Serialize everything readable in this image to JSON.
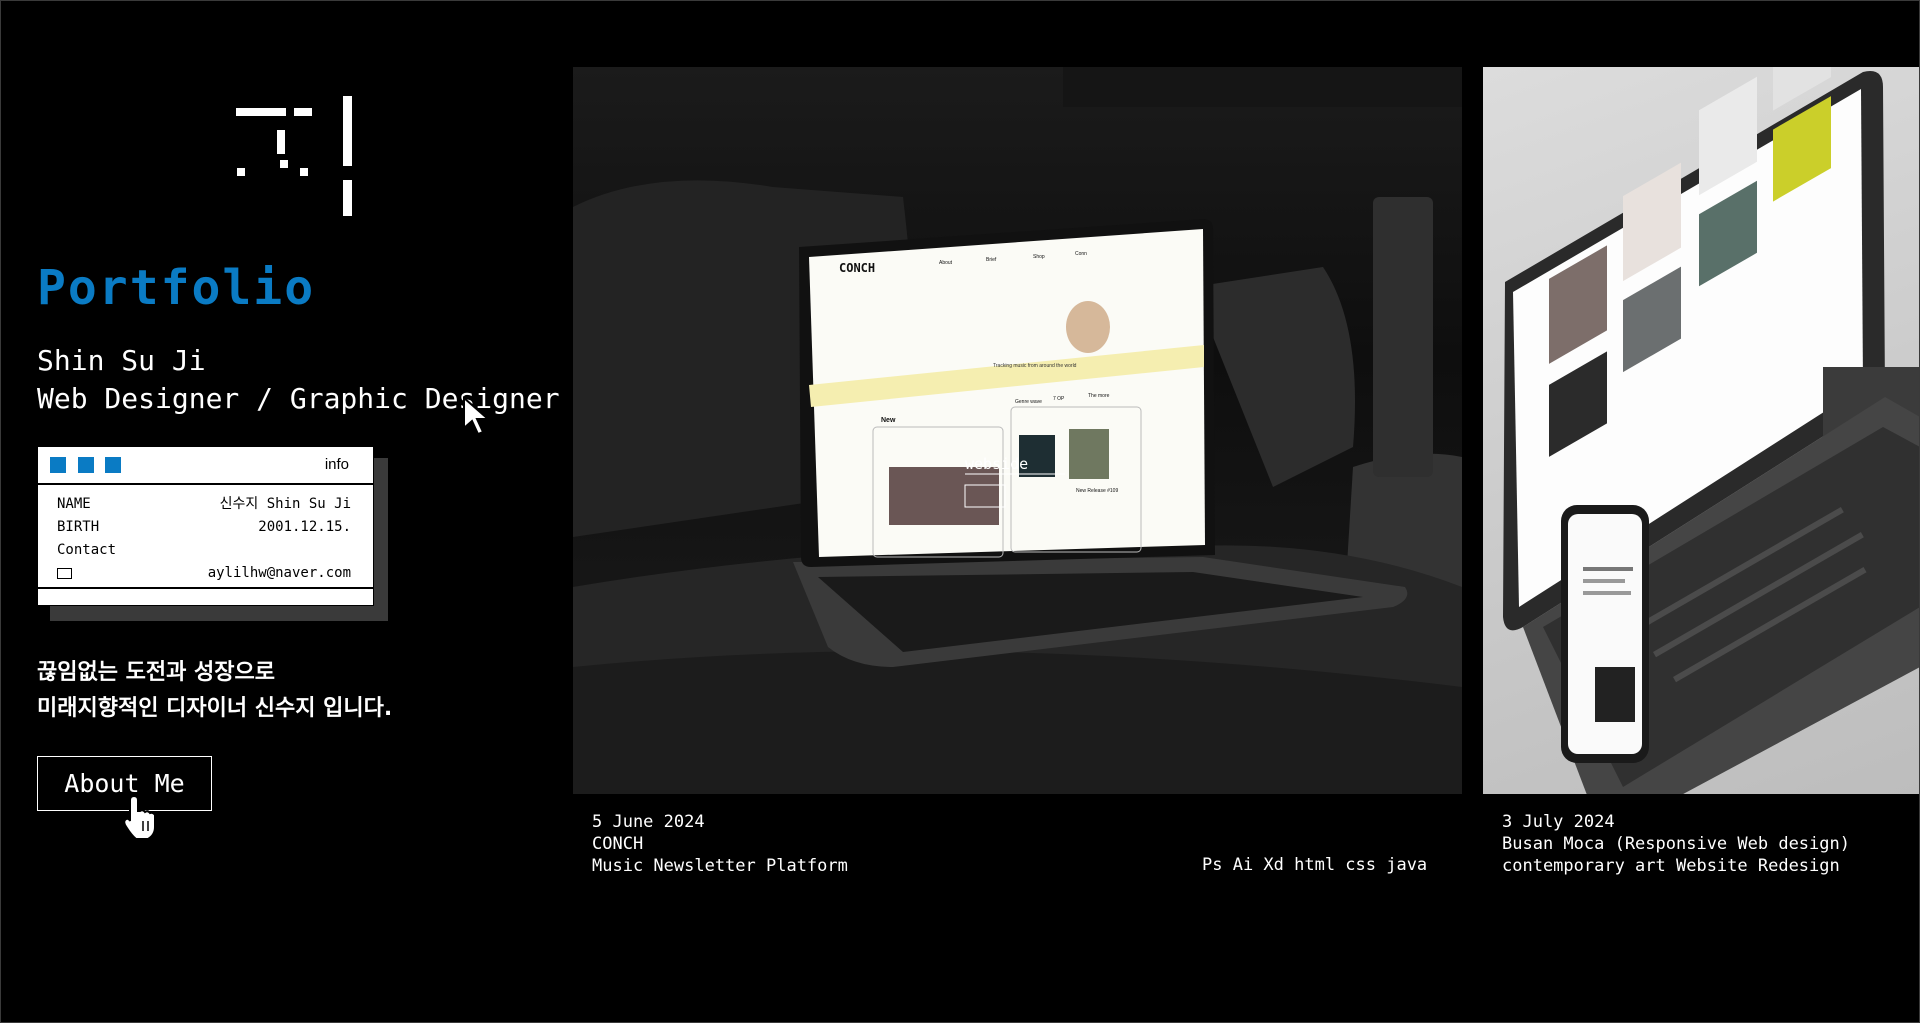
{
  "hero": {
    "title": "Portfolio",
    "name": "Shin Su Ji",
    "role": "Web Designer / Graphic Designer"
  },
  "info_card": {
    "title": "info",
    "rows": [
      {
        "label": "NAME",
        "value": "신수지 Shin Su Ji"
      },
      {
        "label": "BIRTH",
        "value": "2001.12.15."
      },
      {
        "label": "Contact",
        "value": ""
      }
    ],
    "email": "aylilhw@naver.com",
    "accent_color": "#0a7bc4"
  },
  "tagline": {
    "line1": "끊임없는 도전과 성장으로",
    "line2": "미래지향적인 디자이너 신수지 입니다."
  },
  "about_button": "About Me",
  "projects": [
    {
      "date": "5 June 2024",
      "name": "CONCH",
      "description": "Music Newsletter Platform",
      "tools": "Ps Ai Xd html css java",
      "screen": {
        "brand": "CONCH",
        "nav": [
          "About",
          "Brief",
          "Shop",
          "Conn"
        ],
        "tagline": "Tracking music from around the world",
        "section_new": "New",
        "genres": [
          "Genre wave",
          "7 OP",
          "The more"
        ],
        "overlay_text": "webside",
        "release_label": "New Release #109"
      }
    },
    {
      "date": "3 July 2024",
      "name": "Busan Moca (Responsive Web design)",
      "description": "contemporary art Website Redesign"
    }
  ]
}
